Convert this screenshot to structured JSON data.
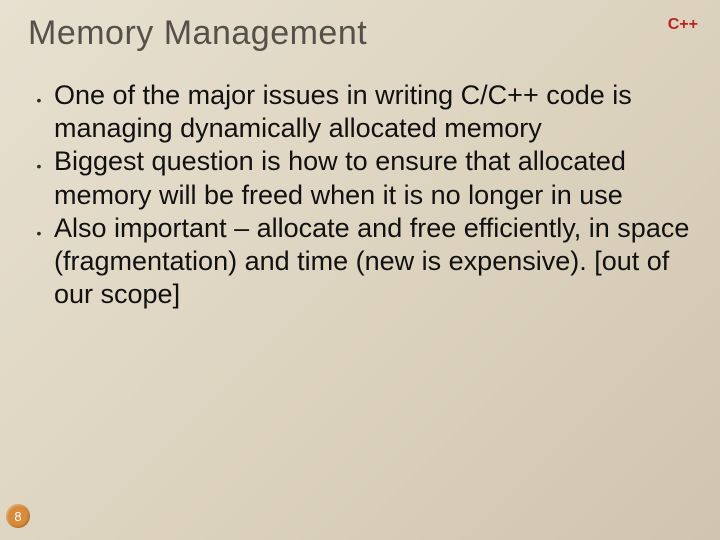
{
  "header": {
    "title": "Memory Management",
    "badge": "C++"
  },
  "bullets": [
    "One of the major issues in writing C/C++ code is managing dynamically allocated memory",
    "Biggest question is how to ensure that allocated memory will be freed when it is no longer in use",
    "Also important – allocate and free efficiently, in space (fragmentation) and time (new is expensive). [out of our scope]"
  ],
  "page_number": "8"
}
